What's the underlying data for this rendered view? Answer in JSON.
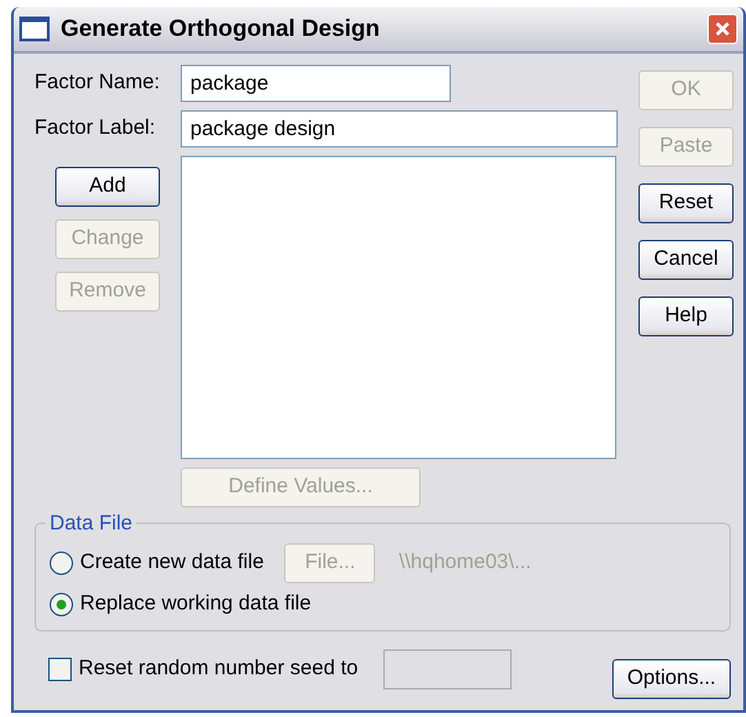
{
  "window": {
    "title": "Generate Orthogonal Design"
  },
  "fields": [
    {
      "label": "Factor Name:",
      "value": "package",
      "kind": "short"
    },
    {
      "label": "Factor Label:",
      "value": "package design",
      "kind": "long"
    }
  ],
  "list_buttons": [
    {
      "label": "Add",
      "disabled": false
    },
    {
      "label": "Change",
      "disabled": true
    },
    {
      "label": "Remove",
      "disabled": true
    }
  ],
  "define_values_button": {
    "label": "Define Values...",
    "disabled": true
  },
  "side_buttons": [
    {
      "label": "OK",
      "disabled": true
    },
    {
      "label": "Paste",
      "disabled": true
    },
    {
      "label": "Reset",
      "disabled": false
    },
    {
      "label": "Cancel",
      "disabled": false
    },
    {
      "label": "Help",
      "disabled": false
    }
  ],
  "data_file": {
    "legend": "Data File",
    "options": [
      {
        "label": "Create new data file",
        "selected": false
      },
      {
        "label": "Replace working data file",
        "selected": true
      }
    ],
    "file_button": {
      "label": "File...",
      "disabled": true
    },
    "path": {
      "text": "\\\\hqhome03\\...",
      "disabled": true
    }
  },
  "seed": {
    "label": "Reset random number seed to",
    "checked": false,
    "field_disabled": true
  },
  "options_button": {
    "label": "Options...",
    "disabled": false
  }
}
